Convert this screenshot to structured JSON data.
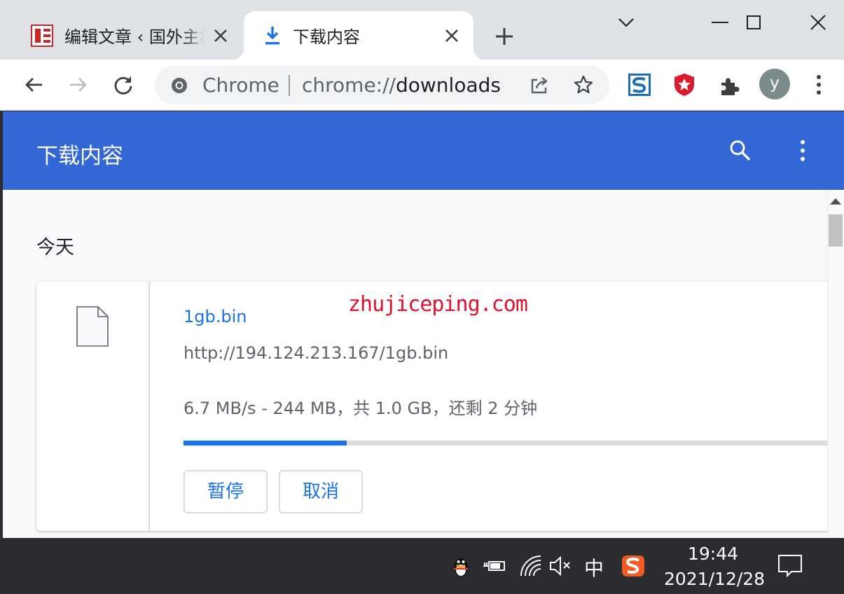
{
  "tabs": [
    {
      "title": "编辑文章 ‹ 国外主机测评",
      "active": false,
      "icon": "edit-article-favicon"
    },
    {
      "title": "下载内容",
      "active": true,
      "icon": "download-icon"
    }
  ],
  "omnibox": {
    "chip": "Chrome",
    "url_scheme": "chrome://",
    "url_host": "downloads"
  },
  "profile": {
    "initial": "y"
  },
  "page": {
    "title": "下载内容",
    "section_date": "今天",
    "watermark": "zhujiceping.com"
  },
  "download": {
    "file_name": "1gb.bin",
    "url": "http://194.124.213.167/1gb.bin",
    "status": "6.7 MB/s - 244 MB，共 1.0 GB，还剩 2 分钟",
    "progress": 0.25,
    "pause_label": "暂停",
    "cancel_label": "取消"
  },
  "taskbar": {
    "ime": "中",
    "time": "19:44",
    "date": "2021/12/28"
  },
  "colors": {
    "header": "#3367d6",
    "accent": "#1a73e8",
    "tabstrip": "#dee1e6",
    "taskbar": "#2a2c30"
  }
}
